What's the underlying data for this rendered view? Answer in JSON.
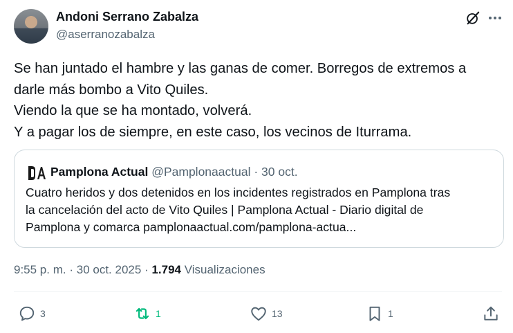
{
  "author": {
    "name": "Andoni Serrano Zabalza",
    "handle": "@aserranozabalza"
  },
  "tweet": {
    "lines": [
      "Se han juntado el hambre y las ganas de comer. Borregos de extremos a",
      "darle más bombo a Vito Quiles.",
      "Viendo la que se ha montado, volverá.",
      "Y a pagar los de siempre, en este caso, los vecinos de Iturrama."
    ]
  },
  "quote": {
    "name": "Pamplona Actual",
    "handle": "@Pamplonaactual",
    "date": "30 oct.",
    "lines": [
      "Cuatro heridos y dos detenidos en los incidentes registrados en Pamplona tras",
      "la cancelación del acto de Vito Quiles | Pamplona Actual - Diario digital de",
      "Pamplona y comarca pamplonaactual.com/pamplona-actua..."
    ]
  },
  "meta": {
    "time": "9:55 p. m.",
    "date": "30 oct. 2025",
    "views_count": "1.794",
    "views_label": "Visualizaciones"
  },
  "actions": {
    "replies": "3",
    "retweets": "1",
    "likes": "13",
    "bookmarks": "1"
  },
  "colors": {
    "text": "#0f1419",
    "secondary": "#536471",
    "retweet_active": "#00ba7c",
    "border": "#cfd9de"
  },
  "icons": [
    "grok-icon",
    "more-icon",
    "reply-icon",
    "retweet-icon",
    "like-icon",
    "bookmark-icon",
    "share-icon"
  ]
}
